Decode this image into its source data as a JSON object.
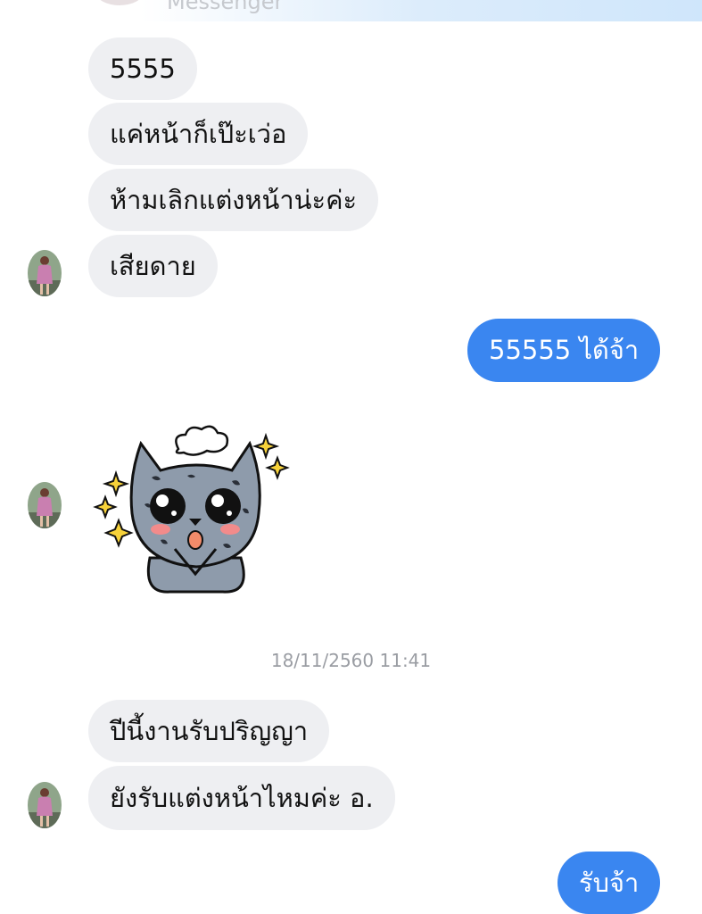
{
  "header": {
    "title": "Messenger"
  },
  "messages": [
    {
      "text": "5555",
      "from": "them"
    },
    {
      "text": "แค่หน้าก็เป๊ะเว่อ",
      "from": "them"
    },
    {
      "text": "ห้ามเลิกแต่งหน้าน่ะค่ะ",
      "from": "them"
    },
    {
      "text": "เสียดาย",
      "from": "them"
    },
    {
      "text": "55555 ได้จ้า",
      "from": "me"
    },
    {
      "sticker": "cat-sticker",
      "from": "them"
    },
    {
      "text": "ปีนี้งานรับปริญญา",
      "from": "them"
    },
    {
      "text": "ยังรับแต่งหน้าไหมค่ะ อ.",
      "from": "them"
    },
    {
      "text": "รับจ้า",
      "from": "me"
    }
  ],
  "timestamp": "18/11/2560 11:41",
  "colors": {
    "outgoing": "#3a86f0",
    "incoming": "#eeeff2",
    "timestamp": "#9a9da3"
  }
}
